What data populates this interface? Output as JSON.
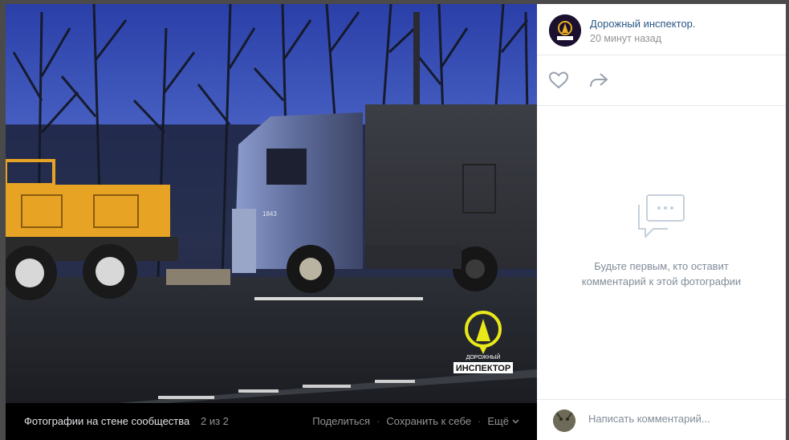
{
  "photo": {
    "description_icon": "photo",
    "watermark_line1": "ДОРОЖНЫЙ",
    "watermark_line2": "ИНСПЕКТОР",
    "truck_badge": "1843"
  },
  "bottom_bar": {
    "album_label": "Фотографии на стене сообщества",
    "counter": "2 из 2",
    "share_label": "Поделиться",
    "save_label": "Сохранить к себе",
    "more_label": "Ещё",
    "separator": "·"
  },
  "side": {
    "author_name": "Дорожный инспектор.",
    "post_time": "20 минут назад",
    "empty_line1": "Будьте первым, кто оставит",
    "empty_line2": "комментарий к этой фотографии",
    "comment_placeholder": "Написать комментарий..."
  },
  "colors": {
    "link": "#2a5885",
    "muted": "#939393",
    "accent_yellow": "#e8e81a"
  }
}
